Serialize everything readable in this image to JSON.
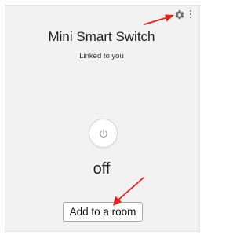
{
  "device": {
    "name": "Mini Smart Switch",
    "link_status": "Linked to you",
    "state": "off"
  },
  "actions": {
    "add_room_label": "Add to a room"
  },
  "icons": {
    "settings": "gear-icon",
    "more": "more-vertical-icon",
    "power": "power-icon"
  },
  "colors": {
    "card_background": "#f2f2f2",
    "annotation_arrow": "#e8211b",
    "icon_gray": "#6a6a6a"
  }
}
